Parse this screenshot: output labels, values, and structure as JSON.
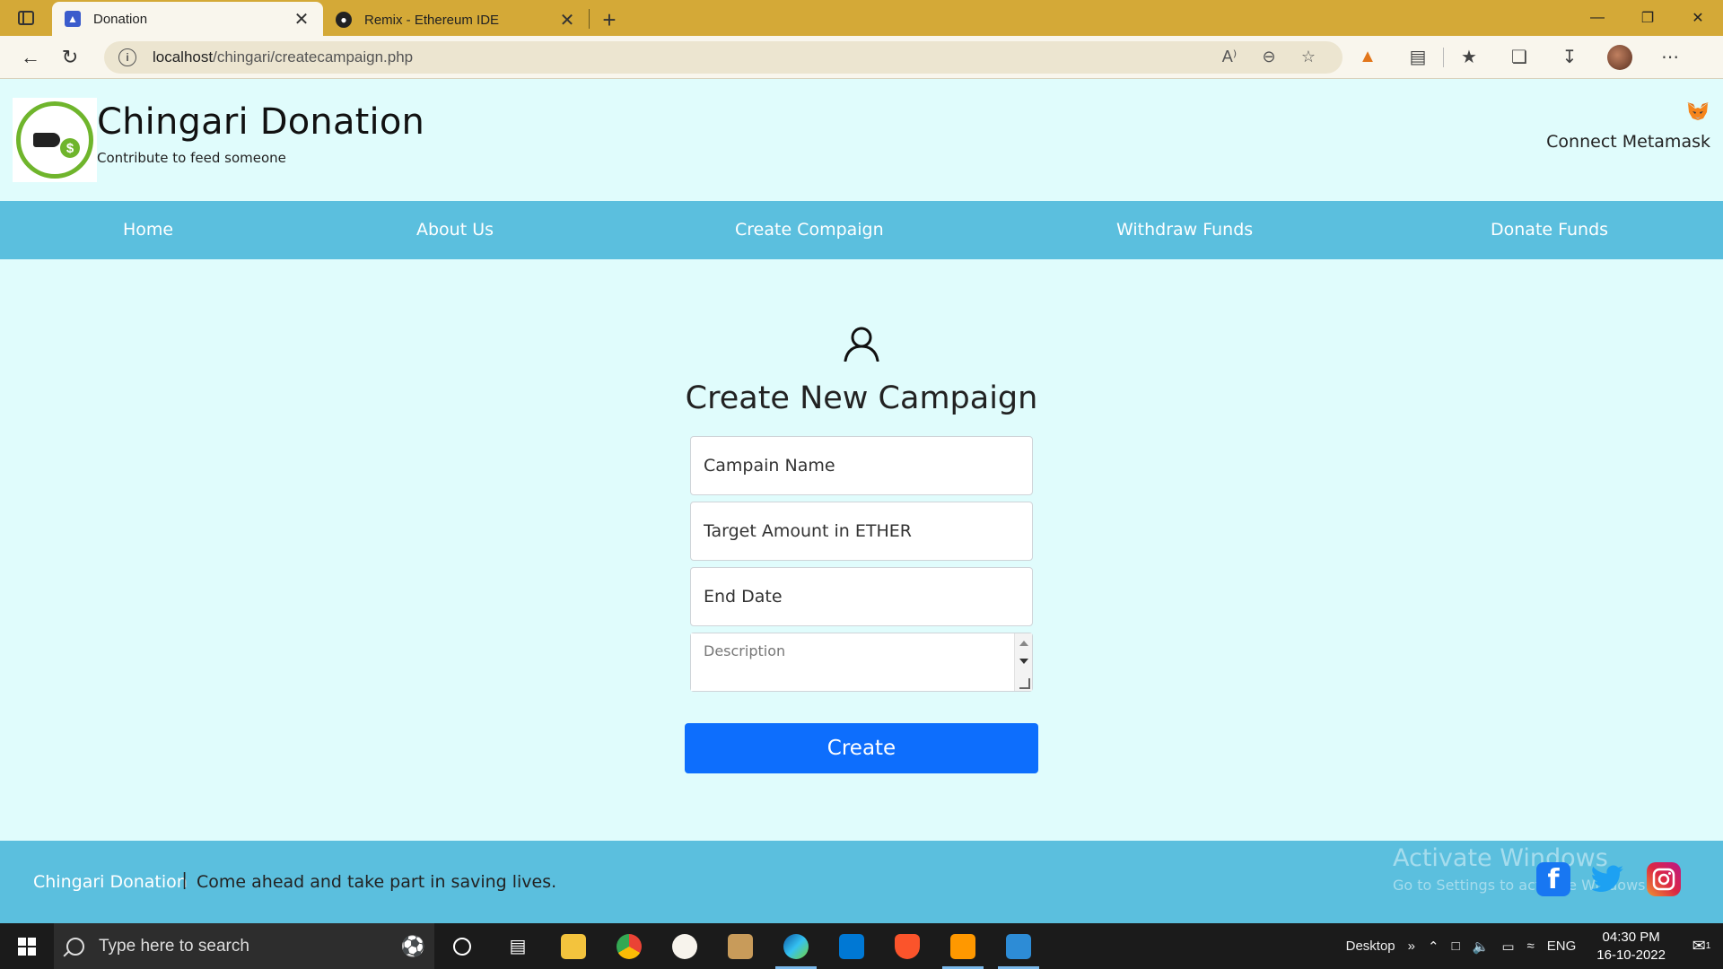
{
  "browser": {
    "tabs": [
      {
        "title": "Donation",
        "active": true,
        "icon": "mortarboard-favicon-icon"
      },
      {
        "title": "Remix - Ethereum IDE",
        "active": false,
        "icon": "remix-favicon-icon"
      }
    ],
    "address": {
      "host": "localhost",
      "path": "/chingari/createcampaign.php"
    },
    "toolbar_icons": [
      "read-aloud-icon",
      "zoom-out-icon",
      "add-favorite-icon",
      "metamask-extension-icon",
      "extension-icon",
      "favorites-icon",
      "collections-icon",
      "downloads-icon",
      "profile-avatar",
      "more-icon"
    ]
  },
  "site": {
    "brand": "Chingari Donation",
    "tagline": "Contribute to feed someone",
    "connect_label": "Connect Metamask",
    "nav": [
      "Home",
      "About Us",
      "Create Compaign",
      "Withdraw Funds",
      "Donate Funds"
    ]
  },
  "form": {
    "title": "Create New Campaign",
    "fields": {
      "name_placeholder": "Campain Name",
      "amount_placeholder": "Target Amount in ETHER",
      "date_placeholder": "End Date",
      "description_placeholder": "Description"
    },
    "submit_label": "Create"
  },
  "footer": {
    "brand": "Chingari Donation",
    "separator": "|",
    "tagline": "Come ahead and take part in saving lives.",
    "watermark_title": "Activate Windows",
    "watermark_sub": "Go to Settings to activate Windows.",
    "social": [
      "facebook-icon",
      "twitter-icon",
      "instagram-icon"
    ]
  },
  "taskbar": {
    "search_placeholder": "Type here to search",
    "desktop_label": "Desktop",
    "language": "ENG",
    "time": "04:30 PM",
    "date": "16-10-2022",
    "notification_count": "1"
  },
  "colors": {
    "page_bg": "#e0fcfc",
    "nav_bg": "#5bbfde",
    "primary_button": "#0d6efd",
    "tabbar_bg": "#d4a937"
  }
}
